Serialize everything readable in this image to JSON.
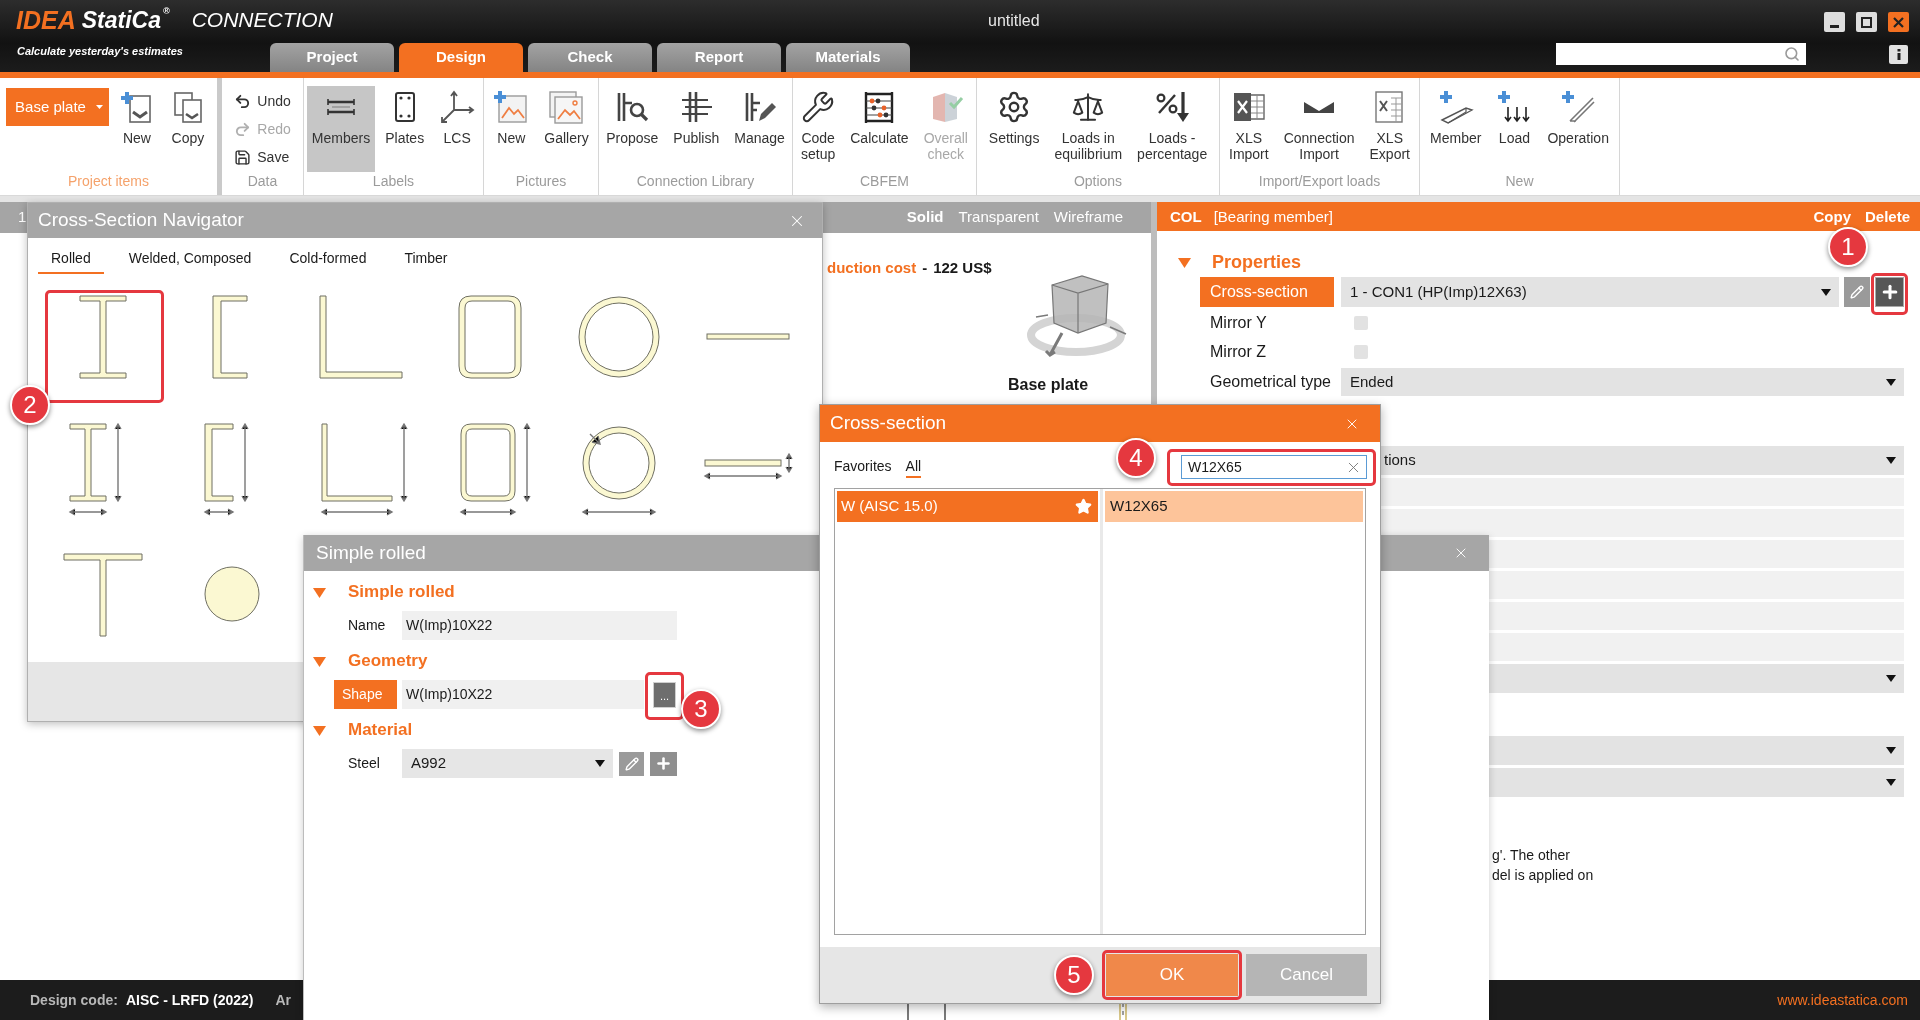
{
  "header": {
    "logo": {
      "brand": "IDEA",
      "name": "StatiCa",
      "mark": "®"
    },
    "product": "CONNECTION",
    "tagline": "Calculate yesterday's estimates",
    "title": "untitled",
    "tabs": [
      {
        "label": "Project",
        "selected": false
      },
      {
        "label": "Design",
        "selected": true
      },
      {
        "label": "Check",
        "selected": false
      },
      {
        "label": "Report",
        "selected": false
      },
      {
        "label": "Materials",
        "selected": false
      }
    ]
  },
  "ribbon": {
    "groups": [
      {
        "label": "Project items",
        "highlighted": true,
        "items": [
          {
            "kind": "dropdown",
            "label": "Base plate",
            "disabled": false
          },
          {
            "kind": "large",
            "label": "New",
            "disabled": false
          },
          {
            "kind": "large",
            "label": "Copy",
            "disabled": false
          }
        ]
      },
      {
        "label": "Data",
        "highlighted": false,
        "items": [
          {
            "kind": "small",
            "label": "Undo",
            "disabled": false
          },
          {
            "kind": "small",
            "label": "Redo",
            "disabled": true
          },
          {
            "kind": "small",
            "label": "Save",
            "disabled": false
          }
        ]
      },
      {
        "label": "Labels",
        "highlighted": false,
        "items": [
          {
            "kind": "large",
            "label": "Members",
            "disabled": false,
            "selected": true
          },
          {
            "kind": "large",
            "label": "Plates",
            "disabled": false,
            "selected": false
          },
          {
            "kind": "large",
            "label": "LCS",
            "disabled": false,
            "selected": false
          }
        ]
      },
      {
        "label": "Pictures",
        "highlighted": false,
        "items": [
          {
            "kind": "large",
            "label": "New",
            "disabled": false
          },
          {
            "kind": "large",
            "label": "Gallery",
            "disabled": false
          }
        ]
      },
      {
        "label": "Connection Library",
        "highlighted": false,
        "items": [
          {
            "kind": "large",
            "label": "Propose",
            "disabled": false
          },
          {
            "kind": "large",
            "label": "Publish",
            "disabled": false
          },
          {
            "kind": "large",
            "label": "Manage",
            "disabled": false
          }
        ]
      },
      {
        "label": "CBFEM",
        "highlighted": false,
        "items": [
          {
            "kind": "large",
            "label": "Code\nsetup",
            "disabled": false
          },
          {
            "kind": "large",
            "label": "Calculate",
            "disabled": false
          },
          {
            "kind": "large",
            "label": "Overall\ncheck",
            "disabled": true
          }
        ]
      },
      {
        "label": "Options",
        "highlighted": false,
        "items": [
          {
            "kind": "large",
            "label": "Settings",
            "disabled": false
          },
          {
            "kind": "large",
            "label": "Loads in\nequilibrium",
            "disabled": false
          },
          {
            "kind": "large",
            "label": "Loads -\npercentage",
            "disabled": false
          }
        ]
      },
      {
        "label": "Import/Export loads",
        "highlighted": false,
        "items": [
          {
            "kind": "large",
            "label": "XLS\nImport",
            "disabled": false
          },
          {
            "kind": "large",
            "label": "Connection\nImport",
            "disabled": false
          },
          {
            "kind": "large",
            "label": "XLS\nExport",
            "disabled": false
          }
        ]
      },
      {
        "label": "New",
        "highlighted": false,
        "items": [
          {
            "kind": "large",
            "label": "Member",
            "disabled": false
          },
          {
            "kind": "large",
            "label": "Load",
            "disabled": false
          },
          {
            "kind": "large",
            "label": "Operation",
            "disabled": false
          }
        ]
      }
    ]
  },
  "viewport": {
    "partial_label": "1",
    "modes": [
      {
        "label": "Solid",
        "selected": true
      },
      {
        "label": "Transparent",
        "selected": false
      },
      {
        "label": "Wireframe",
        "selected": false
      }
    ],
    "cost": {
      "label": "duction cost",
      "separator": "-",
      "value": "122 US$"
    },
    "caption": "Base plate"
  },
  "properties_panel": {
    "member": "COL",
    "role": "[Bearing member]",
    "actions": [
      "Copy",
      "Delete"
    ],
    "section": {
      "title": "Properties",
      "expanded": true
    },
    "rows": [
      {
        "kind": "picker",
        "label": "Cross-section",
        "selected": true,
        "value": "1 - CON1 (HP(Imp)12X63)",
        "step": "1"
      },
      {
        "kind": "checkbox",
        "label": "Mirror Y",
        "selected": false,
        "checked": false
      },
      {
        "kind": "checkbox",
        "label": "Mirror Z",
        "selected": false,
        "checked": false
      },
      {
        "kind": "dropdown",
        "label": "Geometrical type",
        "selected": false,
        "value": "Ended"
      }
    ],
    "covered_groups": [
      {
        "rows": [
          {
            "kind": "dropdown",
            "value": "tions"
          },
          {
            "kind": "field"
          },
          {
            "kind": "field"
          },
          {
            "kind": "field"
          },
          {
            "kind": "field"
          },
          {
            "kind": "field"
          },
          {
            "kind": "field"
          },
          {
            "kind": "dropdown"
          }
        ]
      },
      {
        "rows": [
          {
            "kind": "dropdown"
          },
          {
            "kind": "dropdown"
          }
        ]
      }
    ],
    "note": "g'. The other\ndel is applied on"
  },
  "navigator": {
    "title": "Cross-Section Navigator",
    "tabs": [
      {
        "label": "Rolled",
        "selected": true
      },
      {
        "label": "Welded, Composed",
        "selected": false
      },
      {
        "label": "Cold-formed",
        "selected": false
      },
      {
        "label": "Timber",
        "selected": false
      }
    ],
    "shapes": [
      {
        "kind": "i",
        "step": "2"
      },
      {
        "kind": "channel"
      },
      {
        "kind": "angle"
      },
      {
        "kind": "box"
      },
      {
        "kind": "tube"
      },
      {
        "kind": "flat"
      },
      {
        "kind": "i_dims"
      },
      {
        "kind": "channel_dims"
      },
      {
        "kind": "angle_dims"
      },
      {
        "kind": "box_dims"
      },
      {
        "kind": "tube_dims"
      },
      {
        "kind": "flat_dims"
      },
      {
        "kind": "tee"
      },
      {
        "kind": "round"
      }
    ]
  },
  "simple_rolled": {
    "title": "Simple rolled",
    "sections": [
      {
        "title": "Simple rolled",
        "expanded": true,
        "rows": [
          {
            "kind": "text",
            "label": "Name",
            "selected": false,
            "value": "W(Imp)10X22"
          }
        ]
      },
      {
        "title": "Geometry",
        "expanded": true,
        "rows": [
          {
            "kind": "browse",
            "label": "Shape",
            "selected": true,
            "value": "W(Imp)10X22",
            "button": "...",
            "step": "3"
          }
        ]
      },
      {
        "title": "Material",
        "expanded": true,
        "rows": [
          {
            "kind": "picker",
            "label": "Steel",
            "selected": false,
            "value": "A992"
          }
        ]
      }
    ]
  },
  "cross_section_dialog": {
    "title": "Cross-section",
    "tabs": [
      {
        "label": "Favorites",
        "selected": false
      },
      {
        "label": "All",
        "selected": true
      }
    ],
    "search": {
      "value": "W12X65",
      "step": "4"
    },
    "libraries": [
      {
        "label": "W (AISC 15.0)",
        "selected": true,
        "favorite": true
      }
    ],
    "sections": [
      {
        "label": "W12X65",
        "selected": true
      }
    ],
    "buttons": [
      {
        "kind": "primary",
        "label": "OK",
        "step": "5"
      },
      {
        "kind": "secondary",
        "label": "Cancel"
      }
    ]
  },
  "status_bar": {
    "label": "Design code:",
    "value": "AISC - LRFD (2022)",
    "partial_text": "Ar",
    "link": "www.ideastatica.com"
  }
}
